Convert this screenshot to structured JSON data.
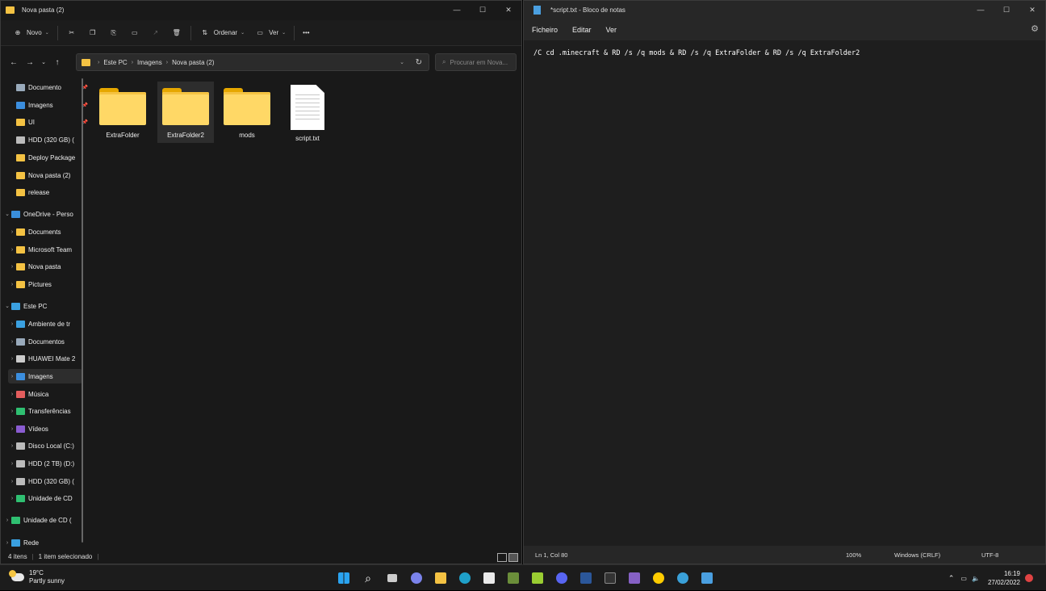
{
  "explorer": {
    "title": "Nova pasta (2)",
    "toolbar": {
      "new_label": "Novo",
      "sort_label": "Ordenar",
      "view_label": "Ver",
      "more_label": "•••"
    },
    "breadcrumb": [
      "Este PC",
      "Imagens",
      "Nova pasta (2)"
    ],
    "search_placeholder": "Procurar em Nova...",
    "sidebar": [
      {
        "label": "Documento",
        "icon": "documents-icon",
        "pinned": true
      },
      {
        "label": "Imagens",
        "icon": "pictures-icon",
        "pinned": true
      },
      {
        "label": "UI",
        "icon": "folder-icon",
        "pinned": true
      },
      {
        "label": "HDD (320 GB) (",
        "icon": "drive-icon"
      },
      {
        "label": "Deploy Package",
        "icon": "folder-icon"
      },
      {
        "label": "Nova pasta (2)",
        "icon": "folder-icon"
      },
      {
        "label": "release",
        "icon": "folder-icon"
      },
      {
        "label": "OneDrive - Perso",
        "icon": "onedrive-icon"
      },
      {
        "label": "Documents",
        "icon": "folder-icon"
      },
      {
        "label": "Microsoft Team",
        "icon": "folder-icon"
      },
      {
        "label": "Nova pasta",
        "icon": "folder-icon"
      },
      {
        "label": "Pictures",
        "icon": "folder-icon"
      },
      {
        "label": "Este PC",
        "icon": "pc-icon"
      },
      {
        "label": "Ambiente de tr",
        "icon": "desktop-icon"
      },
      {
        "label": "Documentos",
        "icon": "documents-icon"
      },
      {
        "label": "HUAWEI Mate 2",
        "icon": "phone-icon"
      },
      {
        "label": "Imagens",
        "icon": "pictures-icon"
      },
      {
        "label": "Música",
        "icon": "music-icon"
      },
      {
        "label": "Transferências",
        "icon": "download-icon"
      },
      {
        "label": "Vídeos",
        "icon": "videos-icon"
      },
      {
        "label": "Disco Local (C:)",
        "icon": "drive-icon"
      },
      {
        "label": "HDD (2 TB) (D:)",
        "icon": "drive-icon"
      },
      {
        "label": "HDD (320 GB) (",
        "icon": "drive-icon"
      },
      {
        "label": "Unidade de CD",
        "icon": "cd-icon"
      },
      {
        "label": "Unidade de CD (",
        "icon": "cd-icon"
      },
      {
        "label": "Rede",
        "icon": "network-icon"
      }
    ],
    "files": [
      {
        "name": "ExtraFolder",
        "type": "folder"
      },
      {
        "name": "ExtraFolder2",
        "type": "folder",
        "selected": true
      },
      {
        "name": "mods",
        "type": "folder"
      },
      {
        "name": "script.txt",
        "type": "text"
      }
    ],
    "status": {
      "count": "4 itens",
      "selected": "1 item selecionado"
    }
  },
  "notepad": {
    "title": "*script.txt - Bloco de notas",
    "menu": [
      "Ficheiro",
      "Editar",
      "Ver"
    ],
    "content": "/C cd .minecraft & RD /s /q mods & RD /s /q ExtraFolder & RD /s /q ExtraFolder2",
    "status": {
      "position": "Ln 1, Col 80",
      "zoom": "100%",
      "eol": "Windows (CRLF)",
      "encoding": "UTF-8"
    }
  },
  "taskbar": {
    "weather": {
      "temp": "19°C",
      "desc": "Partly sunny"
    },
    "time": "16:19",
    "date": "27/02/2022",
    "apps": [
      "start-icon",
      "search-icon",
      "task-view-icon",
      "chat-icon",
      "file-explorer-icon",
      "edge-icon",
      "store-icon",
      "minecraft-icon",
      "notepad-plus-icon",
      "discord-icon",
      "word-icon",
      "terminal-icon",
      "visual-studio-icon",
      "bonzi-icon",
      "browser-icon",
      "notepad-icon"
    ]
  },
  "colors": {
    "folder": "#ffd866",
    "accent": "#0078d4",
    "background": "#191919"
  }
}
